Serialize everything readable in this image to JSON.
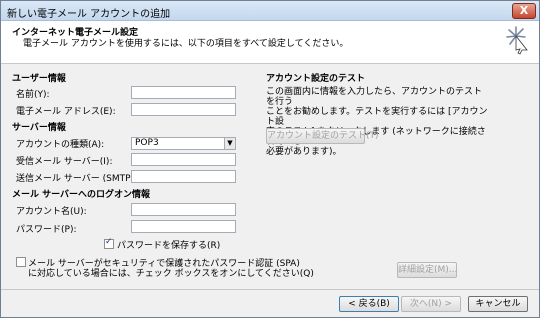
{
  "window": {
    "title": "新しい電子メール アカウントの追加",
    "close": "X"
  },
  "header": {
    "title": "インターネット電子メール設定",
    "subtitle": "電子メール アカウントを使用するには、以下の項目をすべて設定してください。"
  },
  "user_info": {
    "heading": "ユーザー情報",
    "name_label": "名前(Y):",
    "name_value": "",
    "email_label": "電子メール アドレス(E):",
    "email_value": ""
  },
  "server_info": {
    "heading": "サーバー情報",
    "account_type_label": "アカウントの種類(A):",
    "account_type_value": "POP3",
    "incoming_label": "受信メール サーバー(I):",
    "incoming_value": "",
    "outgoing_label": "送信メール サーバー (SMTP)(O):",
    "outgoing_value": ""
  },
  "logon_info": {
    "heading": "メール サーバーへのログオン情報",
    "account_name_label": "アカウント名(U):",
    "account_name_value": "",
    "password_label": "パスワード(P):",
    "password_value": "",
    "save_password_label": "パスワードを保存する(R)",
    "save_password_checked": true,
    "spa_label_line1": "メール サーバーがセキュリティで保護されたパスワード認証 (SPA)",
    "spa_label_line2": "に対応している場合には、チェック ボックスをオンにしてください(Q)",
    "spa_checked": false
  },
  "test": {
    "heading": "アカウント設定のテスト",
    "description_line1": "この画面内に情報を入力したら、アカウントのテストを行う",
    "description_line2": "ことをお勧めします。テストを実行するには [アカウント設",
    "description_line3": "定のテスト] をクリックします (ネットワークに接続されている",
    "description_line4": "必要があります)。",
    "test_button": "アカウント設定のテスト(T)"
  },
  "buttons": {
    "more_settings": "詳細設定(M)...",
    "back": "< 戻る(B)",
    "next": "次へ(N) >",
    "cancel": "キャンセル"
  },
  "icons": {
    "header": "starburst-icon",
    "close": "close-icon",
    "dropdown": "chevron-down-icon"
  }
}
